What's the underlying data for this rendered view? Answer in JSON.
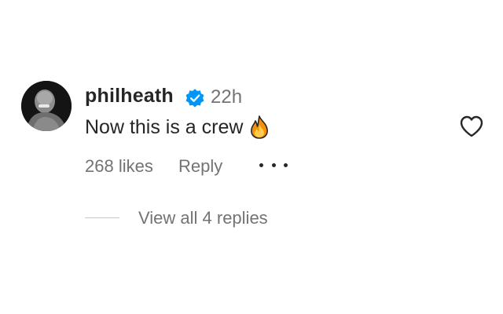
{
  "comment": {
    "username": "philheath",
    "verified_icon": "verified-badge-icon",
    "time_ago": "22h",
    "text": "Now this is a crew",
    "emoji": "fire-emoji-icon",
    "likes_label": "268 likes",
    "reply_label": "Reply",
    "more_icon": "more-options-icon",
    "like_icon": "heart-icon",
    "view_replies_label": "View all 4 replies"
  },
  "colors": {
    "primary_text": "#262626",
    "secondary_text": "#737373",
    "verified_blue": "#0095f6",
    "divider": "#c7c7c7"
  }
}
